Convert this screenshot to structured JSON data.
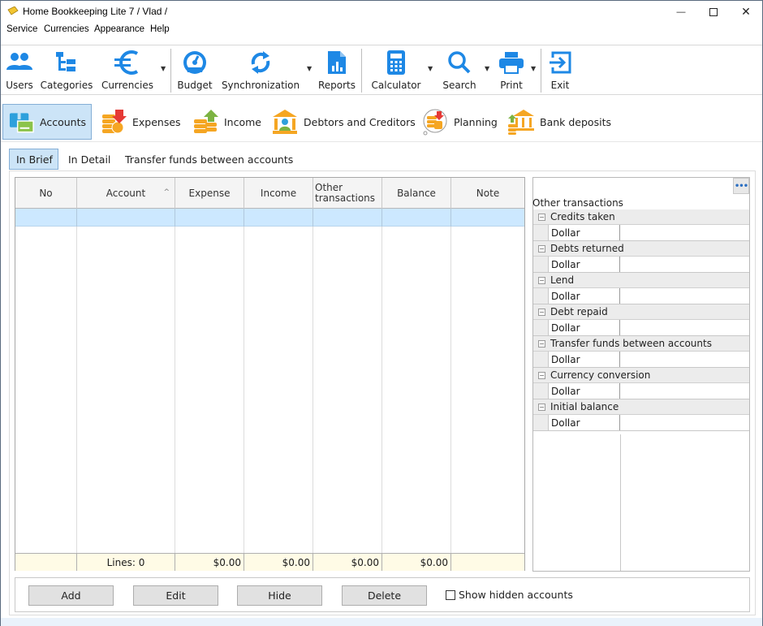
{
  "window": {
    "title": "Home Bookkeeping Lite 7  / Vlad /",
    "controls": {
      "minimize": "—",
      "maximize": "☐",
      "close": "✕"
    }
  },
  "menu": [
    "Service",
    "Currencies",
    "Appearance",
    "Help"
  ],
  "toolbar": {
    "items": [
      {
        "label": "Users",
        "icon": "users-icon"
      },
      {
        "label": "Categories",
        "icon": "categories-icon"
      },
      {
        "label": "Currencies",
        "icon": "euro-icon"
      },
      {
        "label": "Budget",
        "icon": "gauge-icon"
      },
      {
        "label": "Synchronization",
        "icon": "sync-icon"
      },
      {
        "label": "Reports",
        "icon": "report-icon"
      },
      {
        "label": "Calculator",
        "icon": "calculator-icon"
      },
      {
        "label": "Search",
        "icon": "search-icon"
      },
      {
        "label": "Print",
        "icon": "printer-icon"
      },
      {
        "label": "Exit",
        "icon": "exit-icon"
      }
    ],
    "accent": "#1e88e5"
  },
  "sections": [
    {
      "label": "Accounts",
      "active": true
    },
    {
      "label": "Expenses"
    },
    {
      "label": "Income"
    },
    {
      "label": "Debtors and Creditors"
    },
    {
      "label": "Planning"
    },
    {
      "label": "Bank deposits"
    }
  ],
  "subtabs": [
    {
      "label": "In Brief",
      "active": true
    },
    {
      "label": "In Detail"
    },
    {
      "label": "Transfer funds between accounts"
    }
  ],
  "grid": {
    "columns": [
      "No",
      "Account",
      "Expense",
      "Income",
      "Other transactions",
      "Balance",
      "Note"
    ],
    "sort_indicator": "^",
    "rows": [],
    "footer": {
      "no": "",
      "lines": "Lines: 0",
      "expense": "$0.00",
      "income": "$0.00",
      "other": "$0.00",
      "balance": "$0.00",
      "note": ""
    }
  },
  "other_transactions": {
    "title": "Other transactions",
    "more_button": "•••",
    "categories": [
      {
        "label": "Credits taken",
        "rows": [
          {
            "name": "Dollar",
            "value": ""
          }
        ]
      },
      {
        "label": "Debts returned",
        "rows": [
          {
            "name": "Dollar",
            "value": ""
          }
        ]
      },
      {
        "label": "Lend",
        "rows": [
          {
            "name": "Dollar",
            "value": ""
          }
        ]
      },
      {
        "label": "Debt repaid",
        "rows": [
          {
            "name": "Dollar",
            "value": ""
          }
        ]
      },
      {
        "label": "Transfer funds between accounts",
        "rows": [
          {
            "name": "Dollar",
            "value": ""
          }
        ]
      },
      {
        "label": "Currency conversion",
        "rows": [
          {
            "name": "Dollar",
            "value": ""
          }
        ]
      },
      {
        "label": "Initial balance",
        "rows": [
          {
            "name": "Dollar",
            "value": ""
          }
        ]
      }
    ],
    "collapse_glyph": "−"
  },
  "actions": {
    "add": "Add",
    "edit": "Edit",
    "hide": "Hide",
    "delete": "Delete",
    "show_hidden_label": "Show hidden accounts",
    "show_hidden_checked": false
  }
}
